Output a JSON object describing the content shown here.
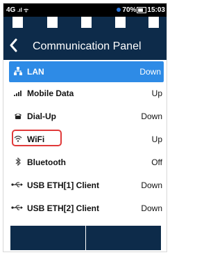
{
  "status_bar": {
    "left_text": "4G",
    "right_text": "70%",
    "time": "15:03"
  },
  "header": {
    "back_icon": "chevron-left-icon",
    "title": "Communication Panel"
  },
  "interfaces": [
    {
      "name": "LAN",
      "state": "Down",
      "icon": "network-icon",
      "selected": true
    },
    {
      "name": "Mobile Data",
      "state": "Up",
      "icon": "signal-bars-icon",
      "selected": false
    },
    {
      "name": "Dial-Up",
      "state": "Down",
      "icon": "phone-icon",
      "selected": false
    },
    {
      "name": "WiFi",
      "state": "Up",
      "icon": "wifi-icon",
      "selected": false,
      "highlighted": true
    },
    {
      "name": "Bluetooth",
      "state": "Off",
      "icon": "bluetooth-icon",
      "selected": false
    },
    {
      "name": "USB ETH[1] Client",
      "state": "Down",
      "icon": "usb-icon",
      "selected": false
    },
    {
      "name": "USB ETH[2] Client",
      "state": "Down",
      "icon": "usb-icon",
      "selected": false
    }
  ],
  "colors": {
    "header_bg": "#0d2b4a",
    "selected_bg": "#2e8be6",
    "highlight_border": "#e03a3a"
  }
}
